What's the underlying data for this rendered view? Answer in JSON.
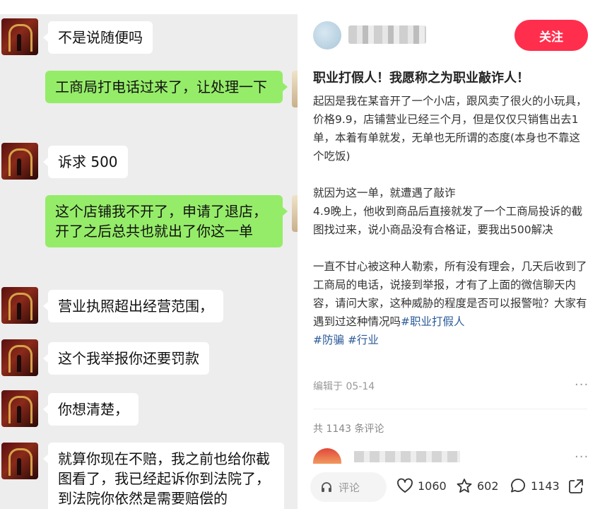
{
  "chat": {
    "messages": [
      {
        "side": "in",
        "text": "不是说随便吗"
      },
      {
        "side": "out",
        "text": "工商局打电话过来了，让处理一下"
      },
      {
        "side": "in",
        "text": "诉求 500"
      },
      {
        "side": "out",
        "text": "这个店铺我不开了，申请了退店，开了之后总共也就出了你这一单"
      },
      {
        "side": "in",
        "text": "营业执照超出经营范围，"
      },
      {
        "side": "in",
        "text": "这个我举报你还要罚款"
      },
      {
        "side": "in",
        "text": "你想清楚，"
      },
      {
        "side": "in",
        "text": "就算你现在不赔，我之前也给你截图看了，我已经起诉你到法院了，到法院你依然是需要赔偿的"
      }
    ]
  },
  "post": {
    "author_name": "用户",
    "follow_label": "关注",
    "title": "职业打假人！我愿称之为职业敲诈人！",
    "paragraphs": [
      "起因是我在某音开了一个小店，跟风卖了很火的小玩具，价格9.9，店铺营业已经三个月，但是仅仅只销售出去1单，本着有单就发，无单也无所谓的态度(本身也不靠这个吃饭)",
      "就因为这一单，就遭遇了敲诈\n4.9晚上，他收到商品后直接就发了一个工商局投诉的截图找过来，说小商品没有合格证，要我出500解决",
      "一直不甘心被这种人勒索，所有没有理会，几天后收到了工商局的电话，说接到举报，才有了上面的微信聊天内容，请问大家，这种威胁的程度是否可以报警啦？大家有遇到过这种情况吗"
    ],
    "tags": [
      "#职业打假人",
      "#防骗",
      "#行业"
    ],
    "edit_date": "编辑于 05-14",
    "more_label": "···",
    "comment_count": "共 1143 条评论",
    "comment_placeholder": "评论",
    "likes": "1060",
    "collects": "602",
    "comments": "1143",
    "accent_color": "#ff2e4d",
    "tag_color": "#2a5a99"
  }
}
